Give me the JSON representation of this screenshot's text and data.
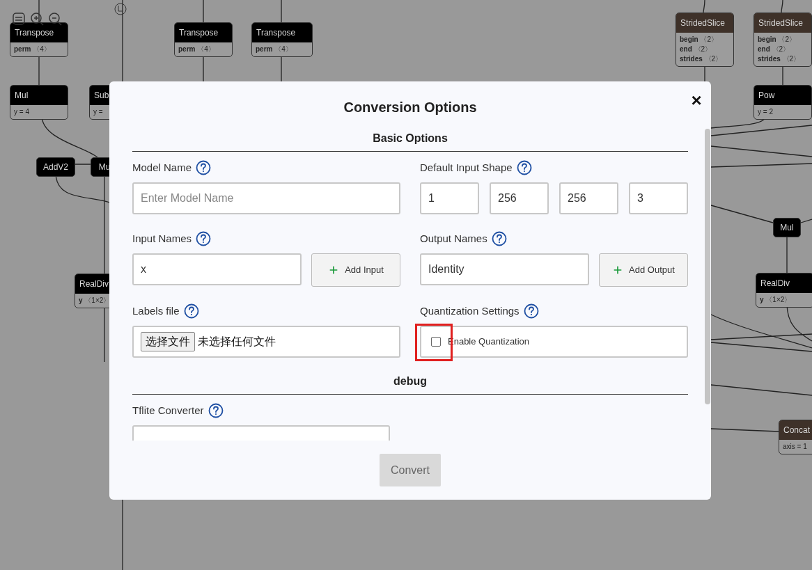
{
  "canvas": {
    "nodes": [
      {
        "title": "Transpose",
        "color": "#000000",
        "attrs": [
          "**perm** 〈4〉"
        ]
      },
      {
        "title": "Transpose",
        "color": "#000000",
        "attrs": [
          "**perm** 〈4〉"
        ]
      },
      {
        "title": "Transpose",
        "color": "#000000",
        "attrs": [
          "**perm** 〈4〉"
        ]
      },
      {
        "title": "Mul",
        "color": "#000000",
        "attrs": [
          "y = 4"
        ]
      },
      {
        "title": "Sub",
        "color": "#000000",
        "attrs": [
          "y ="
        ]
      },
      {
        "title": "AddV2",
        "color": "#000000"
      },
      {
        "title": "Mu",
        "color": "#000000"
      },
      {
        "title": "RealDiv",
        "color": "#000000",
        "attrs": [
          "**y** 〈1×2〉"
        ]
      },
      {
        "title": "StridedSlice",
        "color": "#3e3129",
        "attrs": [
          "**begin** 〈2〉",
          "**end** 〈2〉",
          "**strides** 〈2〉"
        ]
      },
      {
        "title": "StridedSlice",
        "color": "#3e3129",
        "attrs": [
          "**begin** 〈2〉",
          "**end** 〈2〉",
          "**strides** 〈2〉"
        ]
      },
      {
        "title": "Pow",
        "color": "#000000",
        "attrs": [
          "y = 2"
        ]
      },
      {
        "title": "Mul",
        "color": "#000000"
      },
      {
        "title": "RealDiv",
        "color": "#000000",
        "attrs": [
          "**y** 〈1×2〉"
        ]
      },
      {
        "title": "Concat",
        "color": "#3e3129",
        "attrs": [
          "axis = 1"
        ]
      }
    ]
  },
  "dialog": {
    "title": "Conversion Options",
    "close": "×",
    "sections": [
      {
        "heading": "Basic Options",
        "fields": [
          {
            "kind": "text",
            "label": "Model Name",
            "placeholder": "Enter Model Name"
          },
          {
            "kind": "shape",
            "label": "Default Input Shape",
            "values": [
              "1",
              "256",
              "256",
              "3"
            ]
          },
          {
            "kind": "list",
            "label": "Input Names",
            "value": "x",
            "button": "Add Input"
          },
          {
            "kind": "list",
            "label": "Output Names",
            "value": "Identity",
            "button": "Add Output"
          },
          {
            "kind": "file",
            "label": "Labels file",
            "button": "选择文件",
            "status": "未选择任何文件"
          },
          {
            "kind": "checkbox",
            "label": "Quantization Settings",
            "option": "Enable Quantization",
            "checked": false
          }
        ]
      },
      {
        "heading": "debug",
        "fields": [
          {
            "kind": "select",
            "label": "Tflite Converter"
          }
        ]
      }
    ],
    "convert": {
      "label": "Convert",
      "disabled": true
    }
  }
}
